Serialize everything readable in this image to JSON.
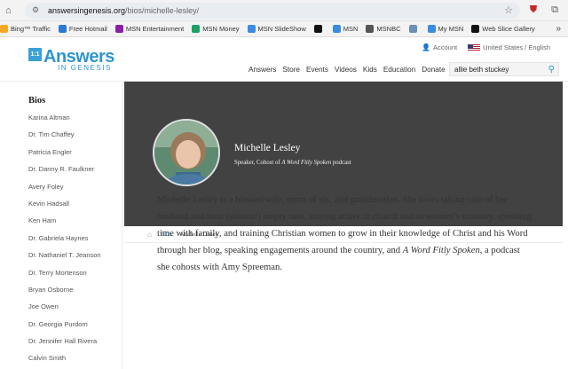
{
  "browser": {
    "url_host": "answersingenesis.org",
    "url_path": "/bios/michelle-lesley/"
  },
  "favorites": [
    {
      "label": "Bing™ Traffic",
      "color": "#f5a623"
    },
    {
      "label": "Free Hotmail",
      "color": "#2b7bd6"
    },
    {
      "label": "MSN Entertainment",
      "color": "#8b1fa8"
    },
    {
      "label": "MSN Money",
      "color": "#1aa260"
    },
    {
      "label": "MSN SlideShow",
      "color": "#3b8be0"
    },
    {
      "label": "",
      "color": "#111111"
    },
    {
      "label": "MSN",
      "color": "#3b8be0"
    },
    {
      "label": "MSNBC",
      "color": "#555555"
    },
    {
      "label": "",
      "color": "#6b8fb5"
    },
    {
      "label": "My MSN",
      "color": "#3b8be0"
    },
    {
      "label": "Web Slice Gallery",
      "color": "#111111"
    }
  ],
  "header": {
    "logo_badge": "1:1",
    "logo_main": "Answers",
    "logo_sub": "IN GENESIS",
    "account": "Account",
    "locale": "United States / English",
    "nav": [
      "Answers",
      "Store",
      "Events",
      "Videos",
      "Kids",
      "Education",
      "Donate"
    ],
    "search_value": "allie beth stuckey"
  },
  "sidebar": {
    "title": "Bios",
    "items": [
      "Karina Altman",
      "Dr. Tim Chaffey",
      "Patricia Engler",
      "Dr. Danny R. Faulkner",
      "Avery Foley",
      "Kevin Hadsall",
      "Ken Ham",
      "Dr. Gabriela Haynes",
      "Dr. Nathaniel T. Jeanson",
      "Dr. Terry Mortenson",
      "Bryan Osborne",
      "Joe Owen",
      "Dr. Georgia Purdom",
      "Dr. Jennifer Hall Rivera",
      "Calvin Smith"
    ]
  },
  "hero": {
    "name": "Michelle Lesley",
    "subtitle_prefix": "Speaker, Cohost of ",
    "subtitle_title": "A Word Fitly Spoken",
    "subtitle_suffix": " podcast"
  },
  "breadcrumb": {
    "link": "Bios",
    "current": "Michelle Lesley"
  },
  "bio": {
    "text_1": "Michelle Lesley is a blessed wife, mom of six, and grandmother. She loves taking care of her husband and their (almost!) empty nest, staying active at church and in women’s ministry, spending time with family, and training Christian women to grow in their knowledge of Christ and his Word through her blog, speaking engagements around the country, and ",
    "podcast": "A Word Fitly Spoken",
    "text_2": ", a podcast she cohosts with Amy Spreeman."
  },
  "colors": {
    "brand_blue": "#2f95d1",
    "hero_bg": "#424242"
  }
}
